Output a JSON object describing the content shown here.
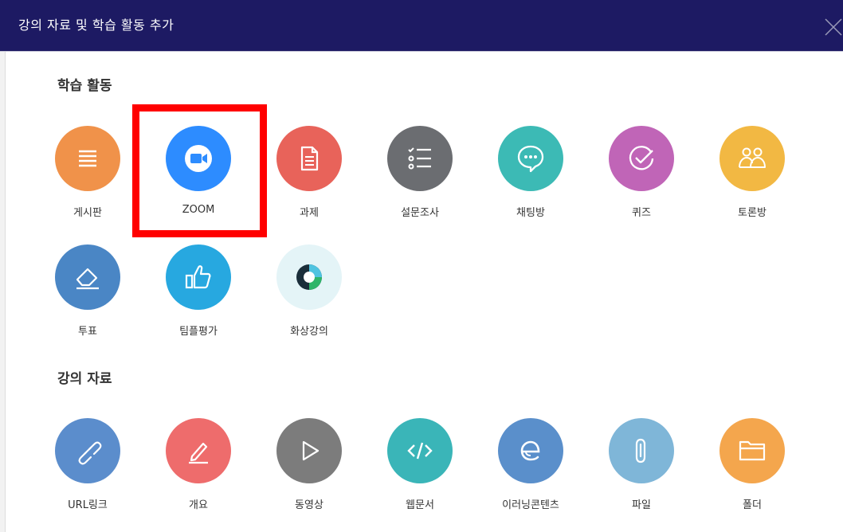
{
  "modal": {
    "title": "강의 자료 및 학습 활동 추가"
  },
  "sections": {
    "activities": {
      "title": "학습 활동"
    },
    "resources": {
      "title": "강의 자료"
    }
  },
  "activities": [
    {
      "label": "게시판",
      "icon": "board-icon",
      "color": "#f0924a"
    },
    {
      "label": "ZOOM",
      "icon": "zoom-video-icon",
      "color": "#2d8cff"
    },
    {
      "label": "과제",
      "icon": "assignment-document-icon",
      "color": "#e8635a"
    },
    {
      "label": "설문조사",
      "icon": "survey-checklist-icon",
      "color": "#6b6d71"
    },
    {
      "label": "채팅방",
      "icon": "chat-bubble-icon",
      "color": "#3cbab5"
    },
    {
      "label": "퀴즈",
      "icon": "quiz-check-icon",
      "color": "#c065b7"
    },
    {
      "label": "토론방",
      "icon": "discussion-people-icon",
      "color": "#f2b843"
    },
    {
      "label": "투표",
      "icon": "vote-eraser-icon",
      "color": "#4a86c5"
    },
    {
      "label": "팀플평가",
      "icon": "thumbs-up-icon",
      "color": "#27a8e0"
    },
    {
      "label": "화상강의",
      "icon": "webex-logo-icon",
      "color": "#e4f4f7"
    }
  ],
  "resources": [
    {
      "label": "URL링크",
      "icon": "link-icon",
      "color": "#5b8dcc"
    },
    {
      "label": "개요",
      "icon": "pencil-icon",
      "color": "#ee6c6c"
    },
    {
      "label": "동영상",
      "icon": "play-icon",
      "color": "#7c7c7c"
    },
    {
      "label": "웹문서",
      "icon": "code-icon",
      "color": "#3ab5b8"
    },
    {
      "label": "이러닝콘텐츠",
      "icon": "elearning-e-icon",
      "color": "#5a8fcb"
    },
    {
      "label": "파일",
      "icon": "paperclip-icon",
      "color": "#7fb6d8"
    },
    {
      "label": "폴더",
      "icon": "folder-icon",
      "color": "#f4a64d"
    }
  ]
}
